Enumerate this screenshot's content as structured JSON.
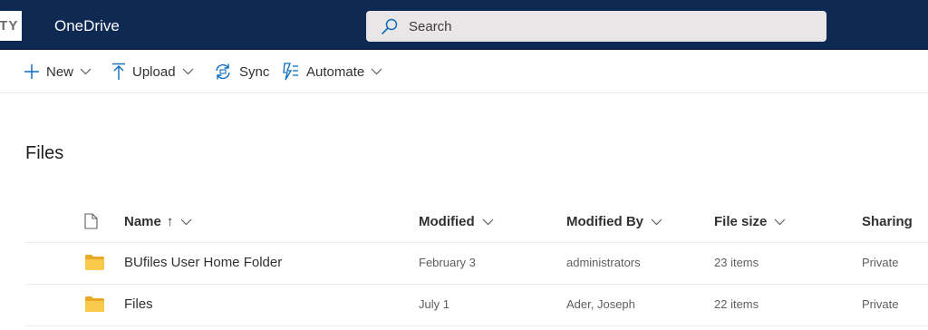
{
  "suite_bar": {
    "logo_text": "ITY",
    "app_name": "OneDrive",
    "search_placeholder": "Search",
    "colors": {
      "background": "#0f2a52",
      "search_bg": "#e8e6e6"
    }
  },
  "command_bar": {
    "new_label": "New",
    "upload_label": "Upload",
    "sync_label": "Sync",
    "automate_label": "Automate",
    "icons": [
      "plus-icon",
      "upload-arrow-icon",
      "sync-icon",
      "automate-icon",
      "chevron-down-icon"
    ],
    "accent_color": "#0f6cbd"
  },
  "page": {
    "title": "Files"
  },
  "table": {
    "columns": {
      "name": "Name",
      "name_sort_glyph": "↑",
      "modified": "Modified",
      "modified_by": "Modified By",
      "file_size": "File size",
      "sharing": "Sharing"
    },
    "rows": [
      {
        "icon": "folder-icon",
        "name": "BUfiles User Home Folder",
        "modified": "February 3",
        "modified_by": "administrators",
        "file_size": "23 items",
        "sharing": "Private"
      },
      {
        "icon": "folder-icon",
        "name": "Files",
        "modified": "July 1",
        "modified_by": "Ader, Joseph",
        "file_size": "22 items",
        "sharing": "Private"
      }
    ],
    "folder_color": "#f8c94b"
  }
}
